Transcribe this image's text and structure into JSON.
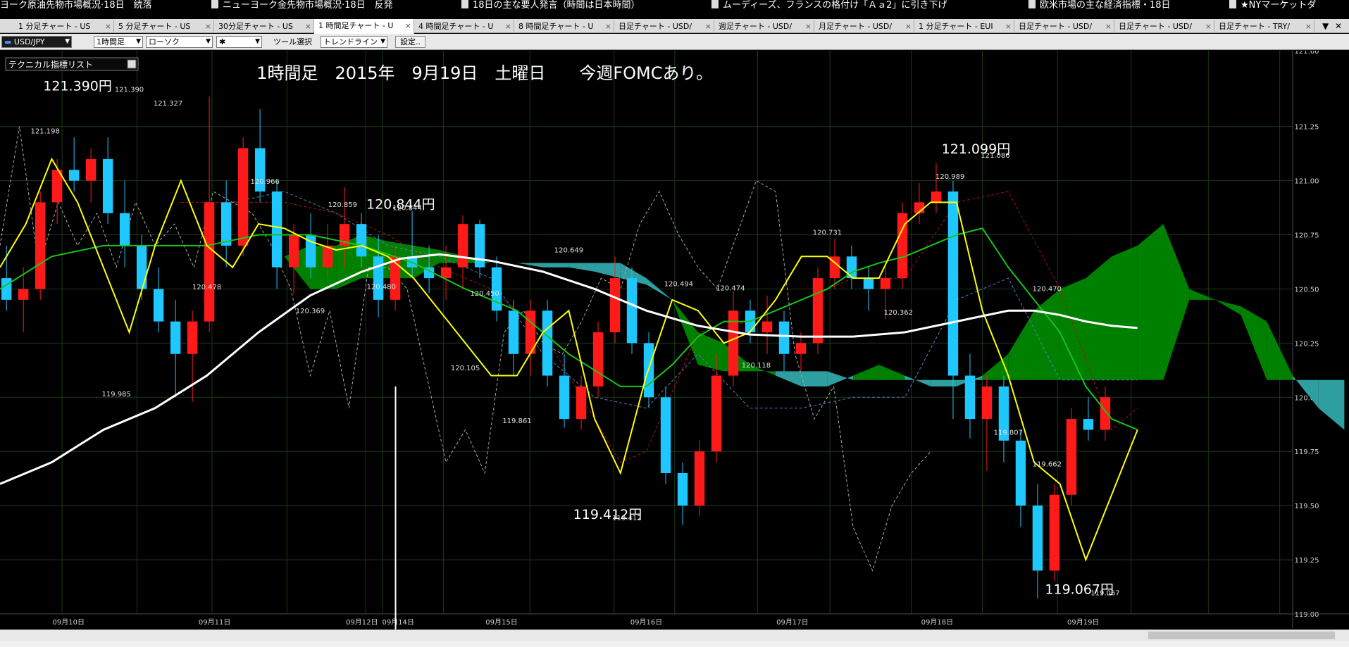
{
  "news": [
    {
      "text": "ヨーク原油先物市場概況·18日　続落",
      "doc": false
    },
    {
      "text": "ニューヨーク金先物市場概況·18日　反発",
      "doc": true
    },
    {
      "text": "18日の主な要人発言（時間は日本時間）",
      "doc": true
    },
    {
      "text": "ムーディーズ、フランスの格付け「Ａａ2」に引き下げ",
      "doc": true
    },
    {
      "text": "欧米市場の主な経済指標・18日",
      "doc": true
    },
    {
      "text": "★NYマーケットダ",
      "doc": true
    }
  ],
  "tabs": [
    {
      "label": "1 分足チャート - US",
      "active": false
    },
    {
      "label": "5 分足チャート - US",
      "active": false
    },
    {
      "label": "30分足チャート - US",
      "active": false
    },
    {
      "label": "1 時間足チャート - U",
      "active": true
    },
    {
      "label": "4 時間足チャート - U",
      "active": false
    },
    {
      "label": "8 時間足チャート - U",
      "active": false
    },
    {
      "label": "日足チャート - USD/",
      "active": false
    },
    {
      "label": "週足チャート - USD/",
      "active": false
    },
    {
      "label": "月足チャート - USD/",
      "active": false
    },
    {
      "label": "1 分足チャート - EUI",
      "active": false
    },
    {
      "label": "日足チャート - USD/",
      "active": false
    },
    {
      "label": "日足チャート - USD/",
      "active": false
    },
    {
      "label": "日足チャート - TRY/",
      "active": false
    }
  ],
  "tab_close": "×",
  "tab_controls": {
    "menu": "▼",
    "close": "✕"
  },
  "toolbar": {
    "pair": "USD/JPY",
    "timeframe": "1時間足",
    "chart_type": "ローソク",
    "marker": "✱",
    "tool_label": "ツール選択",
    "tool_value": "トレンドライン",
    "settings": "設定.."
  },
  "indicator_panel": {
    "label": "テクニカル指標リスト"
  },
  "colors": {
    "up": "#ff1a1a",
    "down": "#1ec8ff",
    "kumo_bull": "#008000",
    "kumo_bear": "#2e9fa0",
    "sma": "#ffffff",
    "tenkan": "#ffff00",
    "kijun": "#18c418",
    "senkou_a": "#b01010",
    "senkou_b": "#5b7bbf",
    "chikou": "#aaaaaa",
    "grid": "#1c3a1c"
  },
  "chart_data": {
    "type": "candlestick",
    "title": "1時間足　2015年　9月19日　土曜日　　今週FOMCあり。",
    "ylim": [
      119.0,
      121.6
    ],
    "yticks": [
      "121.60",
      "121.25",
      "121.00",
      "120.75",
      "120.50",
      "120.25",
      "120.00",
      "119.75",
      "119.50",
      "119.25",
      "119.00"
    ],
    "xticks": [
      "09月10日",
      "09月11日",
      "09月12日",
      "09月14日",
      "09月15日",
      "09月16日",
      "09月17日",
      "09月18日",
      "09月19日"
    ],
    "annotations": [
      {
        "text": "121.390円",
        "price": 121.39,
        "x": 6,
        "size": "big"
      },
      {
        "text": "120.844円",
        "price": 120.844,
        "x": 31,
        "size": "big"
      },
      {
        "text": "121.099円",
        "price": 121.099,
        "x": 75.5,
        "size": "big"
      },
      {
        "text": "119.412円",
        "price": 119.412,
        "x": 47,
        "size": "big"
      },
      {
        "text": "119.067円",
        "price": 119.067,
        "x": 83.5,
        "size": "big"
      },
      {
        "text": "121.390",
        "price": 121.39,
        "x": 10,
        "size": "small"
      },
      {
        "text": "121.198",
        "price": 121.198,
        "x": 3.5,
        "size": "small"
      },
      {
        "text": "121.327",
        "price": 121.327,
        "x": 13,
        "size": "small"
      },
      {
        "text": "120.966",
        "price": 120.966,
        "x": 20.5,
        "size": "small"
      },
      {
        "text": "120.859",
        "price": 120.859,
        "x": 26.5,
        "size": "small"
      },
      {
        "text": "120.844",
        "price": 120.844,
        "x": 31.5,
        "size": "small"
      },
      {
        "text": "120.478",
        "price": 120.478,
        "x": 16,
        "size": "small"
      },
      {
        "text": "120.369",
        "price": 120.369,
        "x": 24,
        "size": "small"
      },
      {
        "text": "120.480",
        "price": 120.48,
        "x": 29.5,
        "size": "small"
      },
      {
        "text": "119.985",
        "price": 119.985,
        "x": 9,
        "size": "small"
      },
      {
        "text": "120.649",
        "price": 120.649,
        "x": 44,
        "size": "small"
      },
      {
        "text": "120.450",
        "price": 120.45,
        "x": 37.5,
        "size": "small"
      },
      {
        "text": "120.105",
        "price": 120.105,
        "x": 36,
        "size": "small"
      },
      {
        "text": "119.861",
        "price": 119.861,
        "x": 40,
        "size": "small"
      },
      {
        "text": "119.412",
        "price": 119.412,
        "x": 48.5,
        "size": "small"
      },
      {
        "text": "120.494",
        "price": 120.494,
        "x": 52.5,
        "size": "small"
      },
      {
        "text": "120.474",
        "price": 120.474,
        "x": 56.5,
        "size": "small"
      },
      {
        "text": "120.118",
        "price": 120.118,
        "x": 58.5,
        "size": "small"
      },
      {
        "text": "120.731",
        "price": 120.731,
        "x": 64,
        "size": "small"
      },
      {
        "text": "120.362",
        "price": 120.362,
        "x": 69.5,
        "size": "small"
      },
      {
        "text": "120.989",
        "price": 120.989,
        "x": 73.5,
        "size": "small"
      },
      {
        "text": "121.086",
        "price": 121.086,
        "x": 77,
        "size": "small"
      },
      {
        "text": "120.470",
        "price": 120.47,
        "x": 81,
        "size": "small"
      },
      {
        "text": "119.807",
        "price": 119.807,
        "x": 78,
        "size": "small"
      },
      {
        "text": "119.662",
        "price": 119.662,
        "x": 81,
        "size": "small"
      },
      {
        "text": "119.067",
        "price": 119.067,
        "x": 85.5,
        "size": "small"
      }
    ],
    "kumo": {
      "x": [
        0,
        5,
        8,
        10,
        12,
        13,
        14,
        16,
        18,
        20,
        22,
        24,
        26,
        28,
        30,
        32,
        34,
        36,
        38,
        40,
        42,
        44,
        46,
        48,
        50,
        52,
        54,
        56,
        58,
        60,
        62,
        64,
        66,
        68,
        70,
        72,
        74,
        76,
        78,
        80,
        82,
        84,
        86,
        88,
        90,
        92,
        94,
        96,
        98,
        100,
        102,
        104
      ],
      "a": [
        119.4,
        119.55,
        119.55,
        119.7,
        119.95,
        120.15,
        120.3,
        120.45,
        120.55,
        120.6,
        120.65,
        120.7,
        120.7,
        120.75,
        120.72,
        120.7,
        120.68,
        120.65,
        120.62,
        120.62,
        120.6,
        120.6,
        120.58,
        120.55,
        120.52,
        120.45,
        120.3,
        120.25,
        120.15,
        120.1,
        120.05,
        120.05,
        120.1,
        120.15,
        120.1,
        120.05,
        120.05,
        120.1,
        120.2,
        120.4,
        120.5,
        120.55,
        120.65,
        120.7,
        120.8,
        120.5,
        120.45,
        120.42,
        120.35,
        120.1,
        119.95,
        119.85
      ],
      "b": [
        119.4,
        119.55,
        119.55,
        119.7,
        119.95,
        120.15,
        120.3,
        120.45,
        120.55,
        120.6,
        120.65,
        120.5,
        120.5,
        120.55,
        120.55,
        120.55,
        120.62,
        120.62,
        120.62,
        120.62,
        120.62,
        120.62,
        120.62,
        120.62,
        120.55,
        120.45,
        120.15,
        120.12,
        120.12,
        120.12,
        120.12,
        120.12,
        120.08,
        120.08,
        120.08,
        120.08,
        120.08,
        120.08,
        120.08,
        120.08,
        120.08,
        120.08,
        120.08,
        120.08,
        120.08,
        120.45,
        120.45,
        120.38,
        120.08,
        120.08,
        120.08,
        120.08
      ]
    },
    "sma": {
      "x": [
        0,
        4,
        8,
        12,
        16,
        20,
        24,
        28,
        31,
        34,
        38,
        42,
        46,
        50,
        54,
        58,
        62,
        66,
        70,
        74,
        78,
        80,
        82,
        84,
        86,
        88
      ],
      "y": [
        119.6,
        119.7,
        119.85,
        119.95,
        120.1,
        120.3,
        120.47,
        120.58,
        120.64,
        120.66,
        120.63,
        120.58,
        120.5,
        120.4,
        120.33,
        120.29,
        120.28,
        120.28,
        120.3,
        120.35,
        120.4,
        120.4,
        120.38,
        120.35,
        120.33,
        120.32
      ]
    },
    "tenkan": {
      "x": [
        0,
        2,
        4,
        6,
        8,
        10,
        12,
        14,
        16,
        18,
        20,
        22,
        24,
        26,
        28,
        30,
        32,
        34,
        36,
        38,
        40,
        42,
        44,
        46,
        48,
        50,
        52,
        54,
        56,
        58,
        60,
        62,
        64,
        66,
        68,
        70,
        72,
        74,
        76,
        78,
        80,
        82,
        84,
        86,
        88
      ],
      "y": [
        120.6,
        120.8,
        121.1,
        120.9,
        120.6,
        120.3,
        120.7,
        121.0,
        120.7,
        120.6,
        120.8,
        120.78,
        120.72,
        120.68,
        120.7,
        120.65,
        120.55,
        120.4,
        120.25,
        120.1,
        120.1,
        120.3,
        120.4,
        119.9,
        119.65,
        120.1,
        120.45,
        120.4,
        120.25,
        120.3,
        120.45,
        120.65,
        120.65,
        120.55,
        120.55,
        120.8,
        120.9,
        120.9,
        120.4,
        120.1,
        119.7,
        119.6,
        119.25,
        119.55,
        119.85
      ]
    },
    "kijun": {
      "x": [
        0,
        4,
        8,
        12,
        16,
        20,
        24,
        28,
        32,
        36,
        40,
        44,
        48,
        50,
        52,
        54,
        56,
        58,
        60,
        62,
        64,
        66,
        68,
        70,
        72,
        74,
        76,
        78,
        80,
        82,
        84,
        86,
        88
      ],
      "y": [
        120.5,
        120.65,
        120.7,
        120.7,
        120.7,
        120.75,
        120.75,
        120.7,
        120.62,
        120.5,
        120.4,
        120.2,
        120.05,
        120.05,
        120.15,
        120.28,
        120.35,
        120.35,
        120.4,
        120.45,
        120.5,
        120.58,
        120.62,
        120.65,
        120.7,
        120.75,
        120.78,
        120.6,
        120.45,
        120.3,
        120.05,
        119.9,
        119.85
      ]
    },
    "senkou_a": {
      "x": [
        14,
        18,
        22,
        26,
        30,
        34,
        38,
        42,
        46,
        48,
        50,
        54,
        58,
        62,
        66,
        70,
        74,
        78,
        82,
        86,
        88
      ],
      "y": [
        120.9,
        120.9,
        120.9,
        120.85,
        120.75,
        120.6,
        120.5,
        120.3,
        119.9,
        119.7,
        119.75,
        120.3,
        120.35,
        120.45,
        120.55,
        120.55,
        120.9,
        120.95,
        120.5,
        119.85,
        119.95
      ]
    },
    "senkou_b": {
      "x": [
        18,
        22,
        26,
        30,
        34,
        38,
        42,
        46,
        50,
        54,
        58,
        62,
        66,
        70,
        74,
        78,
        82,
        86,
        88
      ],
      "y": [
        120.9,
        120.95,
        120.85,
        120.7,
        120.65,
        120.55,
        120.2,
        120.0,
        119.95,
        120.2,
        119.95,
        119.95,
        120.0,
        120.0,
        120.45,
        120.55,
        120.08,
        120.08,
        120.08
      ]
    },
    "chikou": {
      "x": [
        0,
        1.5,
        3,
        4.5,
        6,
        7.5,
        9,
        10.5,
        12,
        13.5,
        15,
        16.5,
        18,
        19.5,
        21,
        22.5,
        24,
        25.5,
        27,
        28.5,
        30,
        31.5,
        33,
        34.5,
        36,
        37.5,
        39,
        40.5,
        42,
        43.5,
        45,
        46.5,
        48,
        49.5,
        51,
        52.5,
        54,
        55.5,
        57,
        58.5,
        60,
        61.5,
        63,
        64.5,
        66,
        67.5,
        69,
        70.5,
        72
      ],
      "y": [
        120.7,
        121.25,
        120.6,
        120.9,
        120.7,
        120.85,
        120.6,
        120.9,
        120.7,
        120.8,
        120.6,
        120.95,
        120.9,
        120.85,
        120.7,
        120.5,
        120.1,
        120.4,
        119.95,
        120.6,
        120.6,
        120.5,
        120.1,
        119.7,
        119.85,
        119.65,
        120.3,
        120.4,
        120.25,
        120.2,
        120.35,
        120.55,
        120.5,
        120.8,
        120.95,
        120.75,
        120.6,
        120.5,
        120.75,
        121.0,
        120.95,
        120.2,
        119.9,
        120.05,
        119.4,
        119.2,
        119.5,
        119.65,
        119.75
      ]
    },
    "candles": [
      [
        120.55,
        120.7,
        120.4,
        120.45
      ],
      [
        120.45,
        120.6,
        120.3,
        120.5
      ],
      [
        120.5,
        120.95,
        120.45,
        120.9
      ],
      [
        120.9,
        121.1,
        120.8,
        121.05
      ],
      [
        121.05,
        121.2,
        120.95,
        121.0
      ],
      [
        121.0,
        121.15,
        120.9,
        121.1
      ],
      [
        121.1,
        121.2,
        120.8,
        120.85
      ],
      [
        120.85,
        121.0,
        120.6,
        120.7
      ],
      [
        120.7,
        120.75,
        120.45,
        120.5
      ],
      [
        120.5,
        120.6,
        120.3,
        120.35
      ],
      [
        120.35,
        120.45,
        120.0,
        120.2
      ],
      [
        120.2,
        120.4,
        119.98,
        120.35
      ],
      [
        120.35,
        121.39,
        120.3,
        120.9
      ],
      [
        120.9,
        121.0,
        120.6,
        120.7
      ],
      [
        120.7,
        121.2,
        120.65,
        121.15
      ],
      [
        121.15,
        121.33,
        120.9,
        120.95
      ],
      [
        120.95,
        121.0,
        120.5,
        120.6
      ],
      [
        120.6,
        120.8,
        120.48,
        120.75
      ],
      [
        120.75,
        120.85,
        120.55,
        120.6
      ],
      [
        120.6,
        120.8,
        120.55,
        120.7
      ],
      [
        120.7,
        120.97,
        120.6,
        120.8
      ],
      [
        120.8,
        120.85,
        120.6,
        120.65
      ],
      [
        120.65,
        120.75,
        120.37,
        120.45
      ],
      [
        120.45,
        120.7,
        120.4,
        120.65
      ],
      [
        120.65,
        120.86,
        120.55,
        120.6
      ],
      [
        120.6,
        120.7,
        120.48,
        120.55
      ],
      [
        120.55,
        120.7,
        120.45,
        120.6
      ],
      [
        120.6,
        120.84,
        120.5,
        120.8
      ],
      [
        120.8,
        120.82,
        120.55,
        120.6
      ],
      [
        120.6,
        120.65,
        120.35,
        120.4
      ],
      [
        120.4,
        120.45,
        120.1,
        120.2
      ],
      [
        120.2,
        120.45,
        120.1,
        120.4
      ],
      [
        120.4,
        120.45,
        120.05,
        120.1
      ],
      [
        120.1,
        120.2,
        119.86,
        119.9
      ],
      [
        119.9,
        120.1,
        119.85,
        120.05
      ],
      [
        120.05,
        120.35,
        120.0,
        120.3
      ],
      [
        120.3,
        120.65,
        120.25,
        120.55
      ],
      [
        120.55,
        120.6,
        120.2,
        120.25
      ],
      [
        120.25,
        120.3,
        119.95,
        120.0
      ],
      [
        120.0,
        120.05,
        119.6,
        119.65
      ],
      [
        119.65,
        119.7,
        119.41,
        119.5
      ],
      [
        119.5,
        119.8,
        119.45,
        119.75
      ],
      [
        119.75,
        120.2,
        119.7,
        120.1
      ],
      [
        120.1,
        120.49,
        120.05,
        120.4
      ],
      [
        120.4,
        120.45,
        120.25,
        120.3
      ],
      [
        120.3,
        120.47,
        120.2,
        120.35
      ],
      [
        120.35,
        120.4,
        120.12,
        120.2
      ],
      [
        120.2,
        120.3,
        120.12,
        120.25
      ],
      [
        120.25,
        120.6,
        120.2,
        120.55
      ],
      [
        120.55,
        120.73,
        120.5,
        120.65
      ],
      [
        120.65,
        120.7,
        120.5,
        120.55
      ],
      [
        120.55,
        120.6,
        120.4,
        120.5
      ],
      [
        120.5,
        120.6,
        120.36,
        120.55
      ],
      [
        120.55,
        120.9,
        120.5,
        120.85
      ],
      [
        120.85,
        120.99,
        120.8,
        120.9
      ],
      [
        120.9,
        121.08,
        120.85,
        120.95
      ],
      [
        120.95,
        121.0,
        119.9,
        120.1
      ],
      [
        120.1,
        120.2,
        119.81,
        119.9
      ],
      [
        119.9,
        120.1,
        119.66,
        120.05
      ],
      [
        120.05,
        120.1,
        119.7,
        119.8
      ],
      [
        119.8,
        119.85,
        119.4,
        119.5
      ],
      [
        119.5,
        119.6,
        119.07,
        119.2
      ],
      [
        119.2,
        119.6,
        119.15,
        119.55
      ],
      [
        119.55,
        119.95,
        119.5,
        119.9
      ],
      [
        119.9,
        120.0,
        119.8,
        119.85
      ],
      [
        119.85,
        120.05,
        119.8,
        120.0
      ]
    ]
  }
}
